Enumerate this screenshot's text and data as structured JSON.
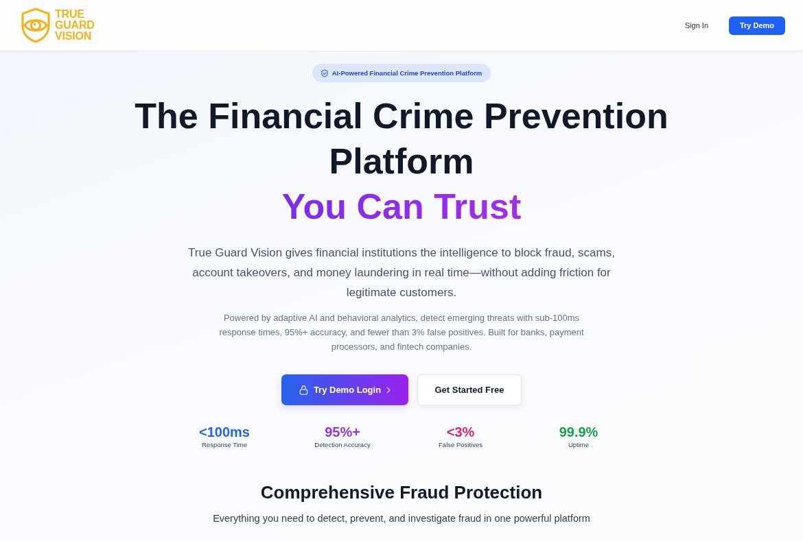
{
  "header": {
    "logo": {
      "name": "TRUE GUARD VISION"
    },
    "nav": [
      {
        "kind": "link",
        "label": "Sign In"
      },
      {
        "kind": "button",
        "label": "Try Demo"
      }
    ]
  },
  "hero": {
    "badge": "AI-Powered Financial Crime Prevention Platform",
    "title": "The Financial Crime Prevention Platform",
    "title_highlight": "You Can Trust",
    "lead": "True Guard Vision gives financial institutions the intelligence to block fraud, scams, account takeovers, and money laundering in real time—without adding friction for legitimate customers.",
    "detail": "Powered by adaptive AI and behavioral analytics, detect emerging threats with sub-100ms response times, 95%+ accuracy, and fewer than 3% false positives. Built for banks, payment processors, and fintech companies.",
    "actions": [
      {
        "kind": "primary",
        "label": "Try Demo Login"
      },
      {
        "kind": "secondary",
        "label": "Get Started Free"
      }
    ],
    "stats": [
      {
        "value": "<100ms",
        "label": "Response Time",
        "color": "#2563eb"
      },
      {
        "value": "95%+",
        "label": "Detection Accuracy",
        "color": "#9333ea"
      },
      {
        "value": "<3%",
        "label": "False Positives",
        "color": "#db2777"
      },
      {
        "value": "99.9%",
        "label": "Uptime",
        "color": "#16a34a"
      }
    ]
  },
  "features": {
    "title": "Comprehensive Fraud Protection",
    "subtitle": "Everything you need to detect, prevent, and investigate fraud in one powerful platform"
  }
}
